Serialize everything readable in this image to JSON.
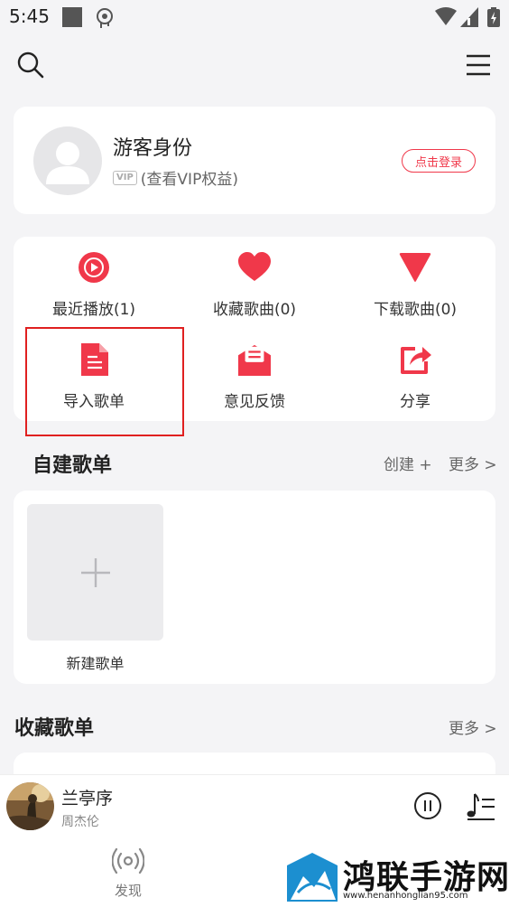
{
  "status_bar": {
    "time": "5:45"
  },
  "profile": {
    "username": "游客身份",
    "vip_badge": "VIP",
    "vip_text": "(查看VIP权益)",
    "login_label": "点击登录"
  },
  "functions": [
    {
      "label": "最近播放(1)",
      "icon": "play-circle-icon"
    },
    {
      "label": "收藏歌曲(0)",
      "icon": "heart-icon"
    },
    {
      "label": "下载歌曲(0)",
      "icon": "download-triangle-icon"
    },
    {
      "label": "导入歌单",
      "icon": "document-icon"
    },
    {
      "label": "意见反馈",
      "icon": "feedback-mail-icon"
    },
    {
      "label": "分享",
      "icon": "share-icon"
    }
  ],
  "my_playlists": {
    "title": "自建歌单",
    "create_label": "创建 +",
    "more_label": "更多 >",
    "new_list_label": "新建歌单"
  },
  "fav_playlists": {
    "title": "收藏歌单",
    "more_label": "更多 >"
  },
  "now_playing": {
    "title": "兰亭序",
    "artist": "周杰伦"
  },
  "bottom_nav": {
    "discover_label": "发现"
  },
  "watermark": {
    "title": "鸿联手游网",
    "url": "www.henanhonglian95.com"
  },
  "colors": {
    "accent": "#f0384a",
    "highlight_box": "#e02020",
    "background": "#f4f4f6"
  }
}
